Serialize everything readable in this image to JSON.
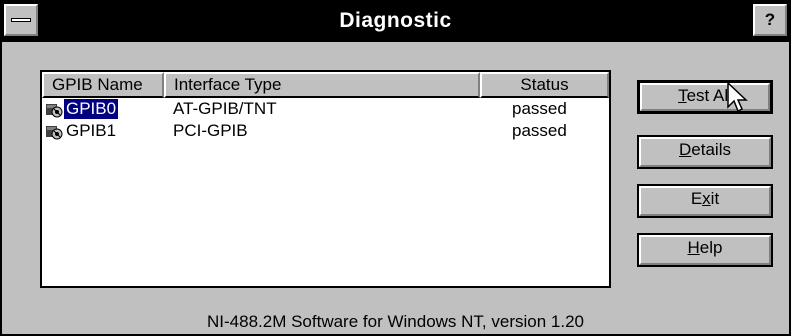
{
  "window": {
    "title": "Diagnostic",
    "help_glyph": "?"
  },
  "list": {
    "columns": [
      "GPIB Name",
      "Interface Type",
      "Status"
    ],
    "rows": [
      {
        "name": "GPIB0",
        "type": "AT-GPIB/TNT",
        "status": "passed",
        "selected": true,
        "icon": "gpib-board-icon"
      },
      {
        "name": "GPIB1",
        "type": "PCI-GPIB",
        "status": "passed",
        "selected": false,
        "icon": "gpib-board-icon"
      }
    ]
  },
  "buttons": {
    "test_all": {
      "mnemonic": "T",
      "rest": "est All"
    },
    "details": {
      "mnemonic": "D",
      "rest": "etails"
    },
    "exit": {
      "pre": "E",
      "mnemonic": "x",
      "rest": "it"
    },
    "help": {
      "mnemonic": "H",
      "rest": "elp"
    }
  },
  "footer": "NI-488.2M Software for Windows NT, version 1.20"
}
